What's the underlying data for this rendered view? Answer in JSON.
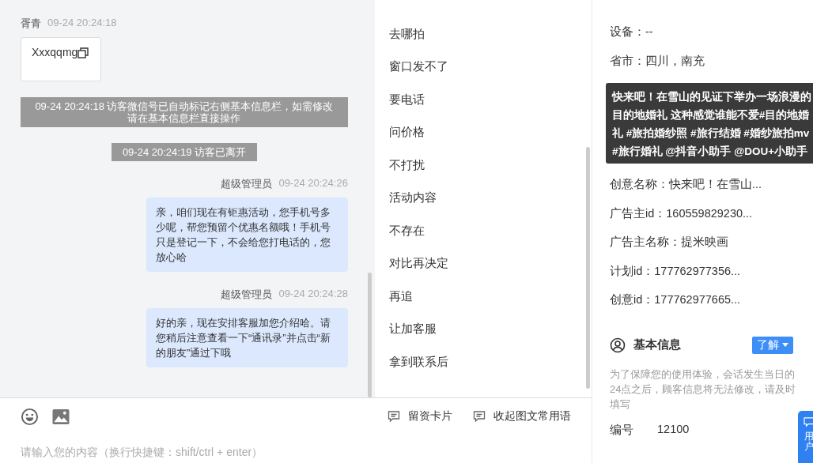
{
  "chat": {
    "messages": [
      {
        "kind": "visitor",
        "sender": "胥青",
        "time": "09-24 20:24:18",
        "text": "Xxxqqmg"
      },
      {
        "kind": "system",
        "text": "09-24 20:24:18 访客微信号已自动标记右侧基本信息栏，如需修改请在基本信息栏直接操作"
      },
      {
        "kind": "system",
        "text": "09-24 20:24:19 访客已离开"
      },
      {
        "kind": "agent",
        "sender": "超级管理员",
        "time": "09-24 20:24:26",
        "text": "亲，咱们现在有钜惠活动，您手机号多少呢，帮您预留个优惠名额哦！手机号只是登记一下，不会给您打电话的，您放心哈"
      },
      {
        "kind": "agent",
        "sender": "超级管理员",
        "time": "09-24 20:24:28",
        "text": "好的亲，现在安排客服加您介绍哈。请您稍后注意查看一下“通讯录”并点击“新的朋友”通过下哦"
      }
    ]
  },
  "phrases": [
    "去哪拍",
    "窗口发不了",
    "要电话",
    "问价格",
    "不打扰",
    "活动内容",
    "不存在",
    "对比再决定",
    "再追",
    "让加客服",
    "拿到联系后"
  ],
  "composer": {
    "actions": [
      "留资卡片",
      "收起图文常用语"
    ],
    "placeholder": "请输入您的内容（换行快捷键：shift/ctrl + enter）"
  },
  "source_info": {
    "fields_top": [
      "设备：--",
      "省市：四川，南充"
    ],
    "fields": [
      "创意名称：快来吧！在雪山...",
      "广告主id：160559829230...",
      "广告主名称：提米映画",
      "计划id：177762977356...",
      "创意id：177762977665..."
    ],
    "tooltip": "快来吧！在雪山的见证下举办一场浪漫的目的地婚礼 这种感觉谁能不爱#目的地婚礼 #旅拍婚纱照 #旅行结婚 #婚纱旅拍mv #旅行婚礼 @抖音小助手 @DOU+小助手"
  },
  "basic_info": {
    "title": "基本信息",
    "button": "了解",
    "notice": "为了保障您的使用体验，会话发生当日的24点之后，顾客信息将无法修改，请及时填写",
    "fields": [
      {
        "label": "编号",
        "value": "12100"
      }
    ]
  },
  "float_button": {
    "label": "用户"
  }
}
